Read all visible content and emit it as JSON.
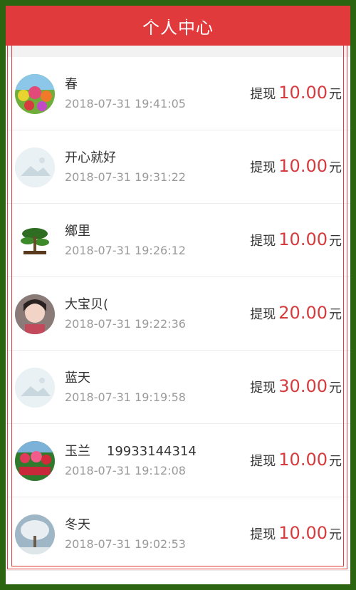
{
  "header": {
    "title": "个人中心"
  },
  "records": [
    {
      "name": "春",
      "time": "2018-07-31 19:41:05",
      "label": "提现",
      "amount": "10.00",
      "unit": "元",
      "avatar": "flowers-avatar"
    },
    {
      "name": "开心就好",
      "time": "2018-07-31 19:31:22",
      "label": "提现",
      "amount": "10.00",
      "unit": "元",
      "avatar": "default-avatar"
    },
    {
      "name": "鄉里",
      "time": "2018-07-31 19:26:12",
      "label": "提现",
      "amount": "10.00",
      "unit": "元",
      "avatar": "bonsai-avatar"
    },
    {
      "name": "大宝贝(",
      "time": "2018-07-31 19:22:36",
      "label": "提现",
      "amount": "20.00",
      "unit": "元",
      "avatar": "portrait-avatar"
    },
    {
      "name": "蓝天",
      "time": "2018-07-31 19:19:58",
      "label": "提现",
      "amount": "30.00",
      "unit": "元",
      "avatar": "default-avatar"
    },
    {
      "name": "玉兰    19933144314",
      "time": "2018-07-31 19:12:08",
      "label": "提现",
      "amount": "10.00",
      "unit": "元",
      "avatar": "flower-bed-avatar"
    },
    {
      "name": "冬天",
      "time": "2018-07-31 19:02:53",
      "label": "提现",
      "amount": "10.00",
      "unit": "元",
      "avatar": "snow-tree-avatar"
    }
  ],
  "colors": {
    "header": "#e03a3d",
    "amount": "#d63b3e",
    "border": "#2c6512"
  }
}
